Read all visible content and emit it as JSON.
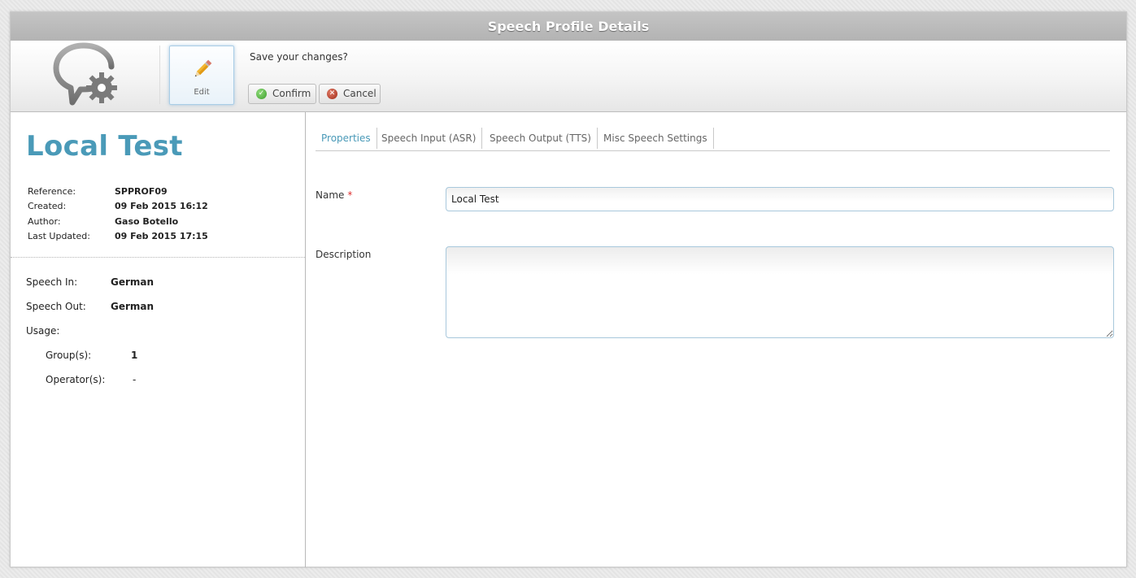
{
  "window": {
    "title": "Speech Profile Details"
  },
  "toolbar": {
    "edit_label": "Edit",
    "prompt": "Save your changes?",
    "confirm_label": "Confirm",
    "cancel_label": "Cancel"
  },
  "profile": {
    "name": "Local Test",
    "meta": [
      {
        "key": "Reference:",
        "value": "SPPROF09"
      },
      {
        "key": "Created:",
        "value": "09 Feb 2015 16:12"
      },
      {
        "key": "Author:",
        "value": "Gaso Botello"
      },
      {
        "key": "Last Updated:",
        "value": "09 Feb 2015 17:15"
      }
    ],
    "speech_in_label": "Speech In:",
    "speech_in": "German",
    "speech_out_label": "Speech Out:",
    "speech_out": "German",
    "usage_label": "Usage:",
    "groups_label": "Group(s):",
    "groups": "1",
    "operators_label": "Operator(s):",
    "operators": "-"
  },
  "tabs": [
    {
      "label": "Properties",
      "active": true
    },
    {
      "label": "Speech Input (ASR)",
      "active": false
    },
    {
      "label": "Speech Output (TTS)",
      "active": false
    },
    {
      "label": "Misc Speech Settings",
      "active": false
    }
  ],
  "form": {
    "name_label": "Name",
    "name_required_mark": "*",
    "name_value": "Local Test",
    "description_label": "Description",
    "description_value": ""
  },
  "colors": {
    "accent": "#4a9ab8",
    "titlebar": "#b8b8b8",
    "confirm_icon": "#3e9d2d",
    "cancel_icon": "#a12b18"
  },
  "icons": {
    "logo": "speech-bubble-gear-icon",
    "edit": "pencil-icon",
    "confirm": "check-circle-icon",
    "cancel": "x-circle-icon"
  }
}
